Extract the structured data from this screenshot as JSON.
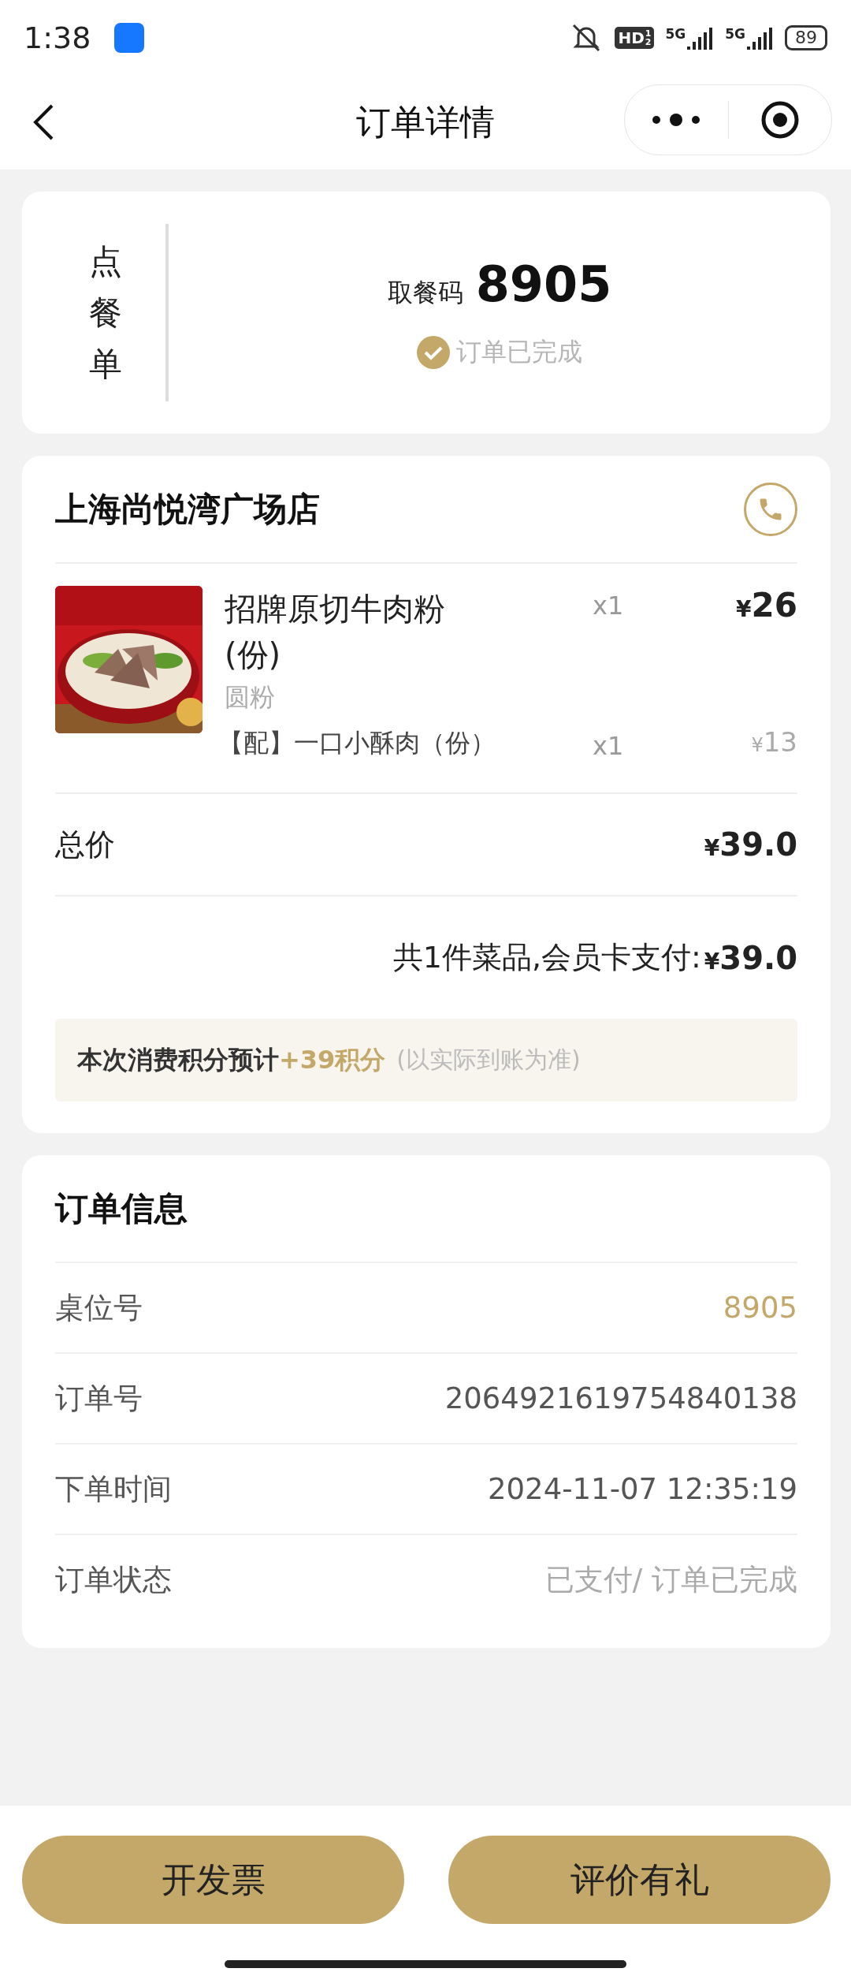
{
  "status_bar": {
    "time": "1:38",
    "hd": "HD",
    "hd_sub": [
      "1",
      "2"
    ],
    "networks": [
      "5G",
      "5G"
    ],
    "battery": "89"
  },
  "nav": {
    "title": "订单详情"
  },
  "pickup_card": {
    "vertical_label": "点餐单",
    "code_label": "取餐码",
    "code": "8905",
    "status": "订单已完成"
  },
  "store": {
    "name": "上海尚悦湾广场店",
    "items": [
      {
        "name": "招牌原切牛肉粉(份)",
        "qty": "x1",
        "currency": "¥",
        "price": "26",
        "spec": "圆粉",
        "addon": {
          "name": "【配】一口小酥肉（份）",
          "qty": "x1",
          "currency": "¥",
          "price": "13"
        }
      }
    ],
    "subtotal": {
      "label": "总价",
      "currency": "¥",
      "value": "39.0"
    },
    "summary": {
      "text": "共1件菜品,会员卡支付:",
      "currency": "¥",
      "value": "39.0"
    },
    "points": {
      "label": "本次消费积分预计",
      "value": "+39积分",
      "note": "(以实际到账为准)"
    }
  },
  "order_info": {
    "title": "订单信息",
    "rows": [
      {
        "label": "桌位号",
        "value": "8905",
        "kind": "accent"
      },
      {
        "label": "订单号",
        "value": "2064921619754840138",
        "kind": "normal"
      },
      {
        "label": "下单时间",
        "value": "2024-11-07 12:35:19",
        "kind": "normal"
      },
      {
        "label": "订单状态",
        "value": "已支付/ 订单已完成",
        "kind": "muted"
      }
    ]
  },
  "buttons": [
    "开发票",
    "评价有礼"
  ]
}
